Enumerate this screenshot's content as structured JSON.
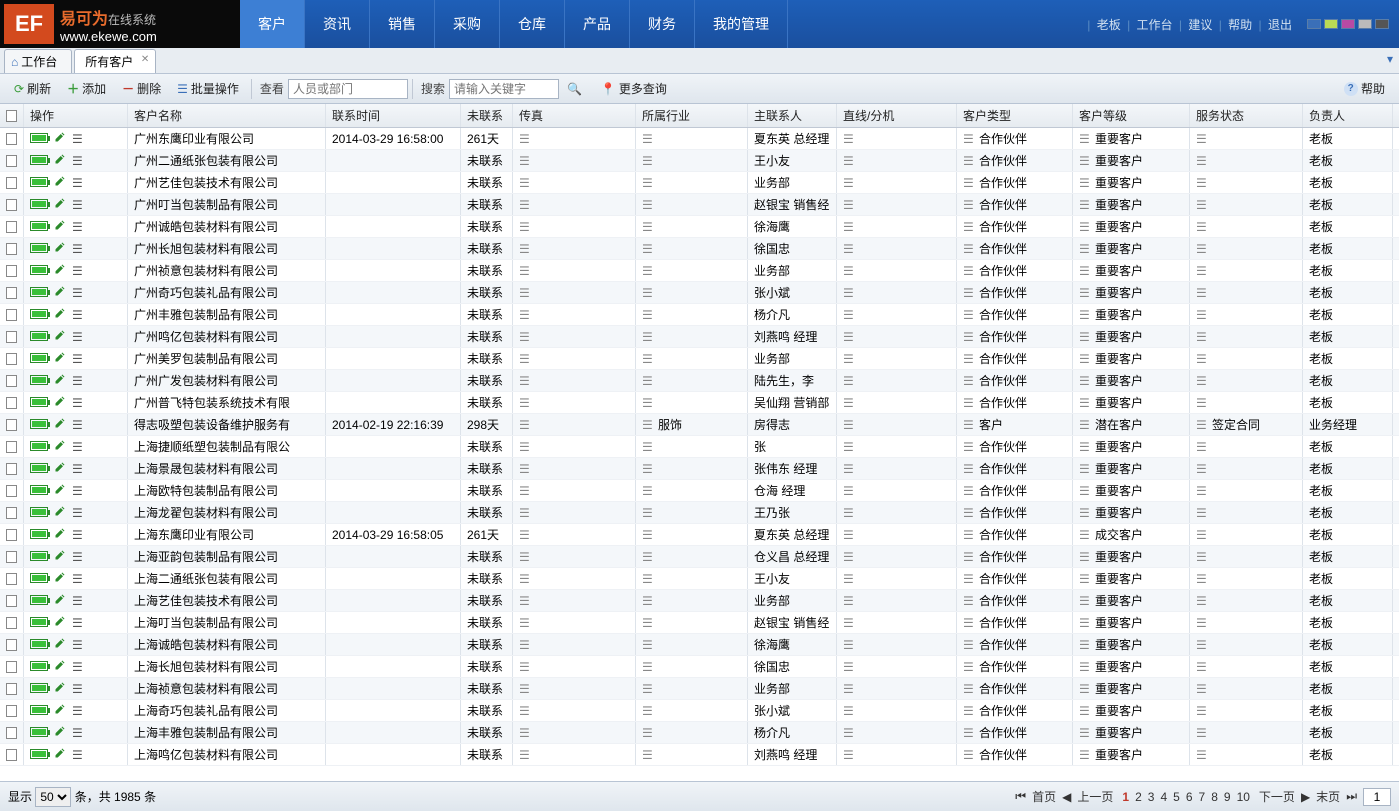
{
  "brand": {
    "name": "易可为",
    "subtitle": "在线系统",
    "url": "www.ekewe.com"
  },
  "nav": [
    "客户",
    "资讯",
    "销售",
    "采购",
    "仓库",
    "产品",
    "财务",
    "我的管理"
  ],
  "header_links": [
    "老板",
    "工作台",
    "建议",
    "帮助",
    "退出"
  ],
  "swatches": [
    "#3a6fb8",
    "#bada55",
    "#b84aa4",
    "#bbbbbb",
    "#555555"
  ],
  "tabs": {
    "home": "工作台",
    "active": "所有客户"
  },
  "toolbar": {
    "refresh": "刷新",
    "add": "添加",
    "delete": "删除",
    "batch": "批量操作",
    "view_label": "查看",
    "view_placeholder": "人员或部门",
    "search_label": "搜索",
    "search_placeholder": "请输入关键字",
    "more": "更多查询",
    "help": "帮助"
  },
  "columns": {
    "act": "操作",
    "name": "客户名称",
    "time": "联系时间",
    "nocontact": "未联系",
    "fax": "传真",
    "industry": "所属行业",
    "contact": "主联系人",
    "ext": "直线/分机",
    "type": "客户类型",
    "level": "客户等级",
    "status": "服务状态",
    "owner": "负责人"
  },
  "rows": [
    {
      "name": "广州东鹰印业有限公司",
      "time": "2014-03-29 16:58:00",
      "nc": "261天",
      "industry": "",
      "contact": "夏东英 总经理",
      "type": "合作伙伴",
      "level": "重要客户",
      "status": "",
      "owner": "老板"
    },
    {
      "name": "广州二通纸张包装有限公司",
      "time": "",
      "nc": "未联系",
      "industry": "",
      "contact": "王小友",
      "type": "合作伙伴",
      "level": "重要客户",
      "status": "",
      "owner": "老板"
    },
    {
      "name": "广州艺佳包装技术有限公司",
      "time": "",
      "nc": "未联系",
      "industry": "",
      "contact": "业务部",
      "type": "合作伙伴",
      "level": "重要客户",
      "status": "",
      "owner": "老板"
    },
    {
      "name": "广州叮当包装制品有限公司",
      "time": "",
      "nc": "未联系",
      "industry": "",
      "contact": "赵银宝 销售经",
      "type": "合作伙伴",
      "level": "重要客户",
      "status": "",
      "owner": "老板"
    },
    {
      "name": "广州诚皓包装材料有限公司",
      "time": "",
      "nc": "未联系",
      "industry": "",
      "contact": "徐海鹰",
      "type": "合作伙伴",
      "level": "重要客户",
      "status": "",
      "owner": "老板"
    },
    {
      "name": "广州长旭包装材料有限公司",
      "time": "",
      "nc": "未联系",
      "industry": "",
      "contact": "徐国忠",
      "type": "合作伙伴",
      "level": "重要客户",
      "status": "",
      "owner": "老板"
    },
    {
      "name": "广州祯意包装材料有限公司",
      "time": "",
      "nc": "未联系",
      "industry": "",
      "contact": "业务部",
      "type": "合作伙伴",
      "level": "重要客户",
      "status": "",
      "owner": "老板"
    },
    {
      "name": "广州奇巧包装礼品有限公司",
      "time": "",
      "nc": "未联系",
      "industry": "",
      "contact": "张小斌",
      "type": "合作伙伴",
      "level": "重要客户",
      "status": "",
      "owner": "老板"
    },
    {
      "name": "广州丰雅包装制品有限公司",
      "time": "",
      "nc": "未联系",
      "industry": "",
      "contact": "杨介凡",
      "type": "合作伙伴",
      "level": "重要客户",
      "status": "",
      "owner": "老板"
    },
    {
      "name": "广州鸣亿包装材料有限公司",
      "time": "",
      "nc": "未联系",
      "industry": "",
      "contact": "刘燕鸣 经理",
      "type": "合作伙伴",
      "level": "重要客户",
      "status": "",
      "owner": "老板"
    },
    {
      "name": "广州美罗包装制品有限公司",
      "time": "",
      "nc": "未联系",
      "industry": "",
      "contact": "业务部",
      "type": "合作伙伴",
      "level": "重要客户",
      "status": "",
      "owner": "老板"
    },
    {
      "name": "广州广发包装材料有限公司",
      "time": "",
      "nc": "未联系",
      "industry": "",
      "contact": "陆先生，李",
      "type": "合作伙伴",
      "level": "重要客户",
      "status": "",
      "owner": "老板"
    },
    {
      "name": "广州普飞特包装系统技术有限",
      "time": "",
      "nc": "未联系",
      "industry": "",
      "contact": "吴仙翔 营销部",
      "type": "合作伙伴",
      "level": "重要客户",
      "status": "",
      "owner": "老板"
    },
    {
      "name": "得志吸塑包装设备维护服务有",
      "time": "2014-02-19 22:16:39",
      "nc": "298天",
      "industry": "服饰",
      "contact": "房得志",
      "type": "客户",
      "level": "潜在客户",
      "status": "签定合同",
      "owner": "业务经理"
    },
    {
      "name": "上海捷顺纸塑包装制品有限公",
      "time": "",
      "nc": "未联系",
      "industry": "",
      "contact": "张",
      "type": "合作伙伴",
      "level": "重要客户",
      "status": "",
      "owner": "老板"
    },
    {
      "name": "上海景晟包装材料有限公司",
      "time": "",
      "nc": "未联系",
      "industry": "",
      "contact": "张伟东 经理",
      "type": "合作伙伴",
      "level": "重要客户",
      "status": "",
      "owner": "老板"
    },
    {
      "name": "上海欧特包装制品有限公司",
      "time": "",
      "nc": "未联系",
      "industry": "",
      "contact": "仓海 经理",
      "type": "合作伙伴",
      "level": "重要客户",
      "status": "",
      "owner": "老板"
    },
    {
      "name": "上海龙翟包装材料有限公司",
      "time": "",
      "nc": "未联系",
      "industry": "",
      "contact": "王乃张",
      "type": "合作伙伴",
      "level": "重要客户",
      "status": "",
      "owner": "老板"
    },
    {
      "name": "上海东鹰印业有限公司",
      "time": "2014-03-29 16:58:05",
      "nc": "261天",
      "industry": "",
      "contact": "夏东英 总经理",
      "type": "合作伙伴",
      "level": "成交客户",
      "status": "",
      "owner": "老板"
    },
    {
      "name": "上海亚韵包装制品有限公司",
      "time": "",
      "nc": "未联系",
      "industry": "",
      "contact": "仓义昌 总经理",
      "type": "合作伙伴",
      "level": "重要客户",
      "status": "",
      "owner": "老板"
    },
    {
      "name": "上海二通纸张包装有限公司",
      "time": "",
      "nc": "未联系",
      "industry": "",
      "contact": "王小友",
      "type": "合作伙伴",
      "level": "重要客户",
      "status": "",
      "owner": "老板"
    },
    {
      "name": "上海艺佳包装技术有限公司",
      "time": "",
      "nc": "未联系",
      "industry": "",
      "contact": "业务部",
      "type": "合作伙伴",
      "level": "重要客户",
      "status": "",
      "owner": "老板"
    },
    {
      "name": "上海叮当包装制品有限公司",
      "time": "",
      "nc": "未联系",
      "industry": "",
      "contact": "赵银宝 销售经",
      "type": "合作伙伴",
      "level": "重要客户",
      "status": "",
      "owner": "老板"
    },
    {
      "name": "上海诚皓包装材料有限公司",
      "time": "",
      "nc": "未联系",
      "industry": "",
      "contact": "徐海鹰",
      "type": "合作伙伴",
      "level": "重要客户",
      "status": "",
      "owner": "老板"
    },
    {
      "name": "上海长旭包装材料有限公司",
      "time": "",
      "nc": "未联系",
      "industry": "",
      "contact": "徐国忠",
      "type": "合作伙伴",
      "level": "重要客户",
      "status": "",
      "owner": "老板"
    },
    {
      "name": "上海祯意包装材料有限公司",
      "time": "",
      "nc": "未联系",
      "industry": "",
      "contact": "业务部",
      "type": "合作伙伴",
      "level": "重要客户",
      "status": "",
      "owner": "老板"
    },
    {
      "name": "上海奇巧包装礼品有限公司",
      "time": "",
      "nc": "未联系",
      "industry": "",
      "contact": "张小斌",
      "type": "合作伙伴",
      "level": "重要客户",
      "status": "",
      "owner": "老板"
    },
    {
      "name": "上海丰雅包装制品有限公司",
      "time": "",
      "nc": "未联系",
      "industry": "",
      "contact": "杨介凡",
      "type": "合作伙伴",
      "level": "重要客户",
      "status": "",
      "owner": "老板"
    },
    {
      "name": "上海鸣亿包装材料有限公司",
      "time": "",
      "nc": "未联系",
      "industry": "",
      "contact": "刘燕鸣 经理",
      "type": "合作伙伴",
      "level": "重要客户",
      "status": "",
      "owner": "老板"
    }
  ],
  "footer": {
    "show": "显示",
    "page_size": "50",
    "unit": "条，共 1985 条",
    "first": "首页",
    "prev": "上一页",
    "pages": [
      "1",
      "2",
      "3",
      "4",
      "5",
      "6",
      "7",
      "8",
      "9",
      "10"
    ],
    "next": "下一页",
    "last": "末页",
    "goto": "1"
  }
}
